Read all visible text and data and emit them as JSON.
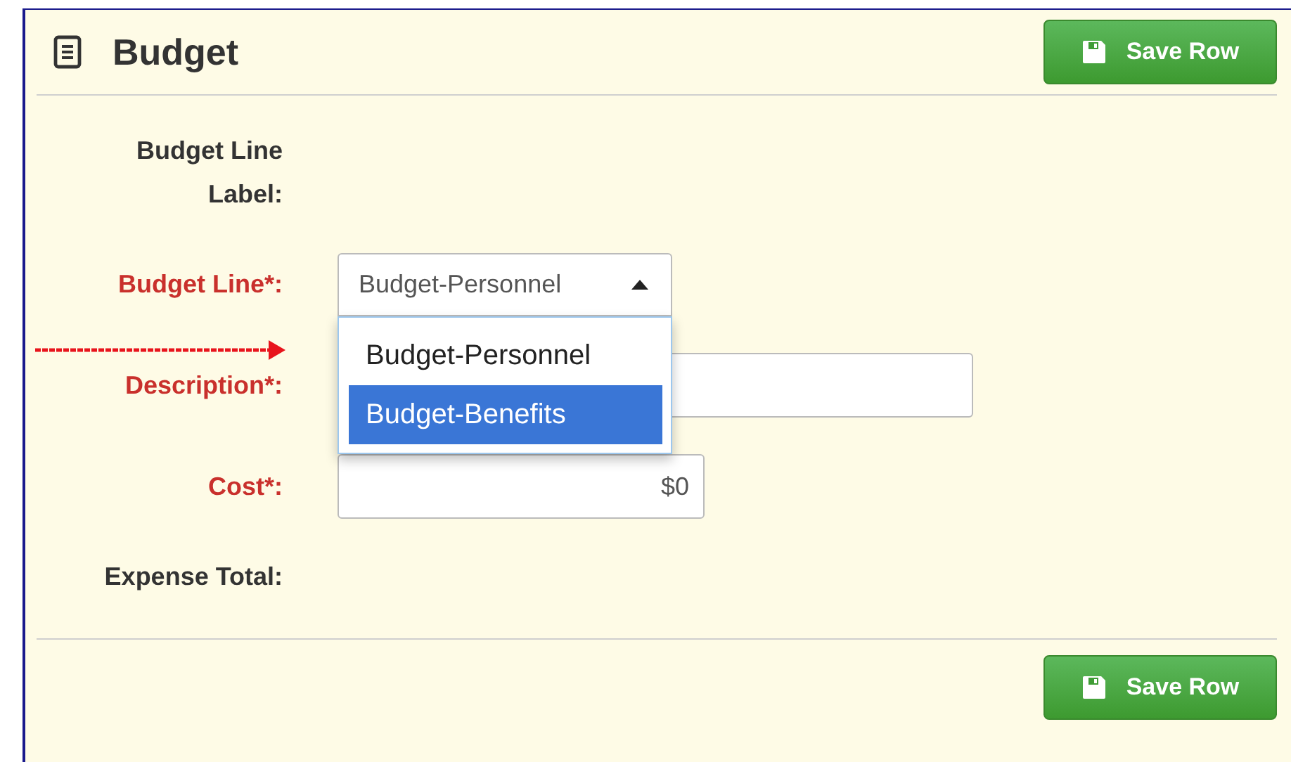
{
  "header": {
    "title": "Budget",
    "button": "Save Row"
  },
  "fields": [
    {
      "label": "Budget Line Label:",
      "kind": "static",
      "required": false
    },
    {
      "label": "Budget Line*:",
      "kind": "select",
      "required": true,
      "value": "Budget-Personnel",
      "expanded": true,
      "options": [
        {
          "label": "Budget-Personnel",
          "highlighted": false
        },
        {
          "label": "Budget-Benefits",
          "highlighted": true
        }
      ]
    },
    {
      "label": "Description*:",
      "kind": "input",
      "required": true
    },
    {
      "label": "Cost*:",
      "kind": "currency",
      "required": true,
      "value": "$0"
    },
    {
      "label": "Expense Total:",
      "kind": "static",
      "required": false
    }
  ],
  "footer": {
    "button": "Save Row"
  }
}
